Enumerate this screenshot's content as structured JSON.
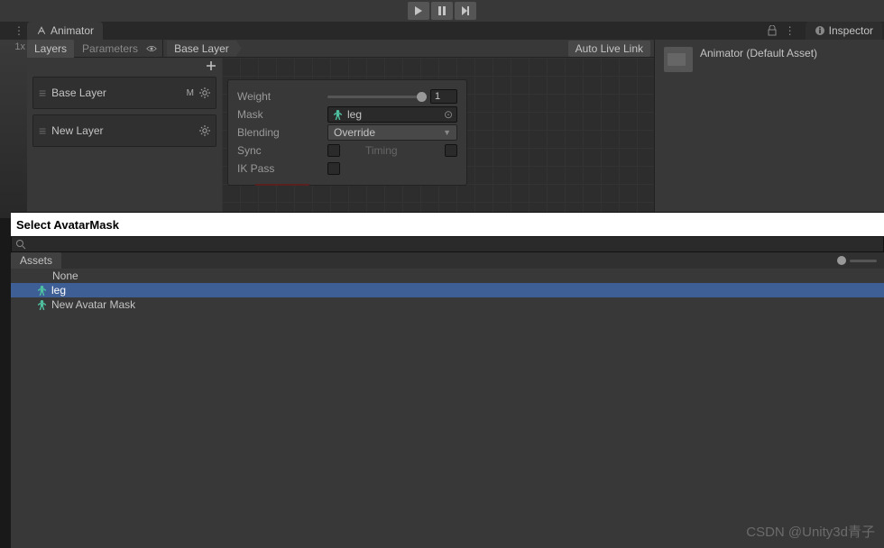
{
  "toolbar": {},
  "animator": {
    "tab_label": "Animator",
    "left_badge": "1x",
    "subtabs": {
      "layers": "Layers",
      "parameters": "Parameters"
    },
    "breadcrumb": "Base Layer",
    "auto_live_link": "Auto Live Link",
    "layers": [
      {
        "name": "Base Layer",
        "badge": "M"
      },
      {
        "name": "New Layer",
        "badge": ""
      }
    ],
    "popup": {
      "weight_label": "Weight",
      "weight_value": "1",
      "mask_label": "Mask",
      "mask_value": "leg",
      "blending_label": "Blending",
      "blending_value": "Override",
      "sync_label": "Sync",
      "timing_label": "Timing",
      "ikpass_label": "IK Pass"
    }
  },
  "inspector": {
    "tab_label": "Inspector",
    "asset_title": "Animator (Default Asset)"
  },
  "dialog": {
    "title": "Select AvatarMask",
    "search_value": "",
    "tab_assets": "Assets",
    "items": [
      {
        "label": "None",
        "icon": false,
        "selected": false
      },
      {
        "label": "leg",
        "icon": true,
        "selected": true
      },
      {
        "label": "New Avatar Mask",
        "icon": true,
        "selected": false
      }
    ]
  },
  "watermark": "CSDN @Unity3d青子"
}
